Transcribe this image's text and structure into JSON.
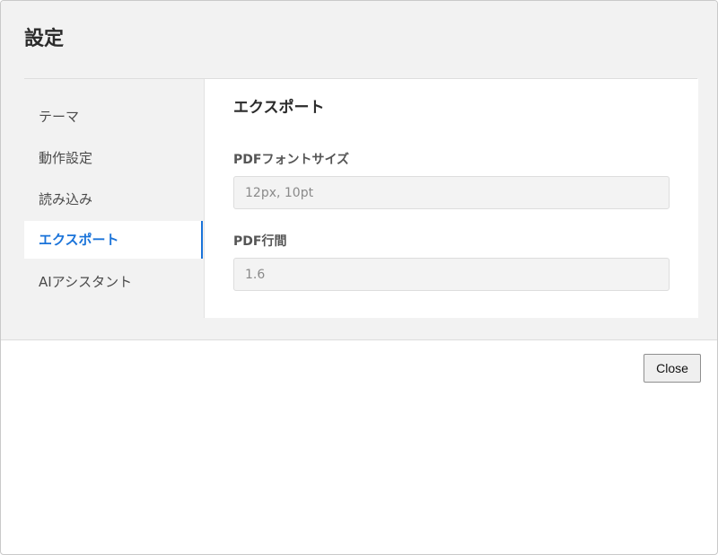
{
  "dialog": {
    "title": "設定",
    "close_label": "Close"
  },
  "sidebar": {
    "items": [
      {
        "label": "テーマ",
        "active": false
      },
      {
        "label": "動作設定",
        "active": false
      },
      {
        "label": "読み込み",
        "active": false
      },
      {
        "label": "エクスポート",
        "active": true
      },
      {
        "label": "AIアシスタント",
        "active": false
      }
    ]
  },
  "export": {
    "title": "エクスポート",
    "pdf_font_size": {
      "label": "PDFフォントサイズ",
      "value": "",
      "placeholder": "12px, 10pt"
    },
    "pdf_line_height": {
      "label": "PDF行間",
      "value": "",
      "placeholder": "1.6"
    }
  },
  "colors": {
    "accent": "#1a73d9",
    "panel_background": "#f2f2f2",
    "content_background": "#ffffff"
  }
}
